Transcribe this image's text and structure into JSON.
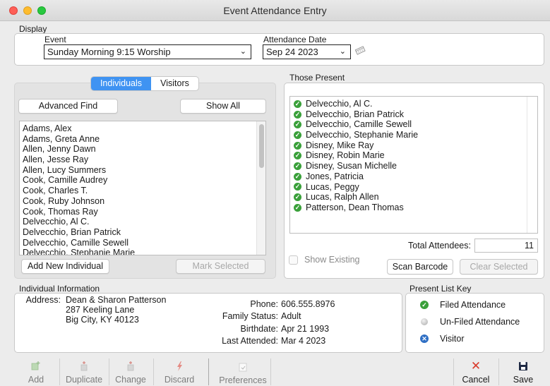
{
  "window": {
    "title": "Event Attendance Entry"
  },
  "display": {
    "section_label": "Display",
    "event_label": "Event",
    "event_value": "Sunday Morning 9:15 Worship",
    "date_label": "Attendance Date",
    "date_value": "Sep 24 2023"
  },
  "lookup": {
    "tabs": [
      {
        "label": "Individuals",
        "active": true
      },
      {
        "label": "Visitors",
        "active": false
      }
    ],
    "advanced_find_label": "Advanced Find",
    "show_all_label": "Show All",
    "names": [
      "Adams, Alex",
      "Adams, Greta Anne",
      "Allen, Jenny Dawn",
      "Allen, Jesse Ray",
      "Allen, Lucy Summers",
      "Cook, Camille Audrey",
      "Cook, Charles T.",
      "Cook, Ruby Johnson",
      "Cook, Thomas Ray",
      "Delvecchio, Al C.",
      "Delvecchio, Brian Patrick",
      "Delvecchio, Camille Sewell",
      "Delvecchio, Stephanie Marie"
    ],
    "add_new_label": "Add New Individual",
    "mark_selected_label": "Mark Selected"
  },
  "present": {
    "section_label": "Those Present",
    "names": [
      "Delvecchio, Al C.",
      "Delvecchio, Brian Patrick",
      "Delvecchio, Camille Sewell",
      "Delvecchio, Stephanie Marie",
      "Disney, Mike Ray",
      "Disney, Robin Marie",
      "Disney, Susan Michelle",
      "Jones, Patricia",
      "Lucas, Peggy",
      "Lucas, Ralph Allen",
      "Patterson, Dean Thomas"
    ],
    "total_label": "Total Attendees:",
    "total_value": "11",
    "show_existing_label": "Show Existing",
    "scan_barcode_label": "Scan Barcode",
    "clear_selected_label": "Clear Selected"
  },
  "individual_info": {
    "section_label": "Individual Information",
    "address_label": "Address:",
    "address_lines": [
      "Dean & Sharon Patterson",
      "287 Keeling Lane",
      "Big City, KY 40123"
    ],
    "phone_label": "Phone:",
    "phone_value": "606.555.8976",
    "family_status_label": "Family Status:",
    "family_status_value": "Adult",
    "birthdate_label": "Birthdate:",
    "birthdate_value": "Apr 21 1993",
    "last_attended_label": "Last Attended:",
    "last_attended_value": "Mar 4 2023"
  },
  "key": {
    "section_label": "Present List Key",
    "items": [
      {
        "icon": "filed-check-icon",
        "label": "Filed Attendance",
        "color": "#3aa03a"
      },
      {
        "icon": "unfiled-dot-icon",
        "label": "Un-Filed Attendance",
        "color": "#bdbdbd"
      },
      {
        "icon": "visitor-x-icon",
        "label": "Visitor",
        "color": "#2f6fc4"
      }
    ]
  },
  "toolbar": {
    "add": "Add",
    "duplicate": "Duplicate",
    "change": "Change",
    "discard": "Discard",
    "preferences": "Preferences",
    "cancel": "Cancel",
    "save": "Save"
  },
  "colors": {
    "accent": "#3f93f2",
    "filed": "#3aa03a",
    "visitor": "#2f6fc4",
    "cancel_red": "#d93a2b"
  }
}
